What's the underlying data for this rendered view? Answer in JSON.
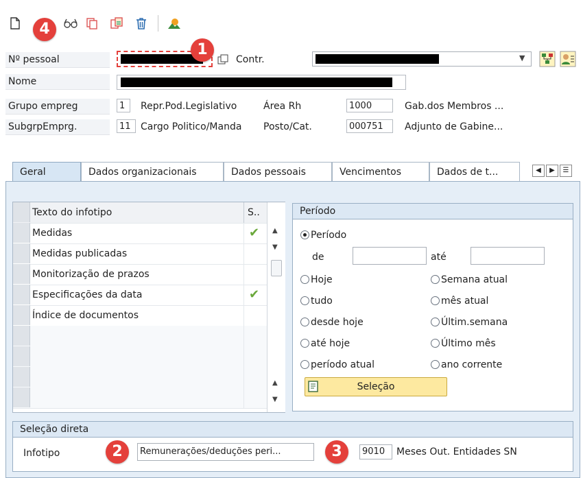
{
  "toolbar": {
    "icons": [
      "new-document-icon",
      "glasses-icon",
      "copy-icon",
      "change-icon",
      "delete-icon",
      "overview-icon"
    ]
  },
  "header": {
    "personal_no_label": "Nº pessoal",
    "contract_label": "Contr.",
    "name_label": "Nome",
    "emp_group_label": "Grupo empreg",
    "emp_group_value": "1",
    "emp_group_text": "Repr.Pod.Legislativo",
    "hr_area_label": "Área Rh",
    "hr_area_value": "1000",
    "hr_area_text": "Gab.dos Membros ...",
    "emp_subgroup_label": "SubgrpEmprg.",
    "emp_subgroup_value": "11",
    "emp_subgroup_text": "Cargo Politico/Manda",
    "position_label": "Posto/Cat.",
    "position_value": "000751",
    "position_text": "Adjunto de Gabine..."
  },
  "tabs": [
    "Geral",
    "Dados organizacionais",
    "Dados pessoais",
    "Vencimentos",
    "Dados de t..."
  ],
  "infotype_table": {
    "col_text": "Texto do infotipo",
    "col_status": "S..",
    "rows": [
      {
        "text": "Medidas",
        "status": true
      },
      {
        "text": "Medidas publicadas",
        "status": false
      },
      {
        "text": "Monitorização de prazos",
        "status": false
      },
      {
        "text": "Especificações da data",
        "status": true
      },
      {
        "text": "Índice de documentos",
        "status": false
      }
    ]
  },
  "periodo": {
    "title": "Período",
    "radio_periodo": "Período",
    "de_label": "de",
    "ate_label": "até",
    "de_value": "",
    "ate_value": "",
    "options": [
      "Hoje",
      "Semana atual",
      "tudo",
      "mês atual",
      "desde hoje",
      "Últim.semana",
      "até hoje",
      "Último mês",
      "período atual",
      "ano corrente"
    ],
    "selection_button": "Seleção"
  },
  "direct": {
    "title": "Seleção direta",
    "infotipo_label": "Infotipo",
    "infotipo_value": "Remunerações/deduções peri...",
    "code_value": "9010",
    "code_text": "Meses Out. Entidades SN"
  },
  "badges": [
    "1",
    "2",
    "3",
    "4"
  ],
  "colors": {
    "badge": "#e4403b",
    "panel_bg": "#e5eef7",
    "active_tab": "#d7e6f4",
    "check": "#6aa83b",
    "button": "#fde9a0"
  }
}
